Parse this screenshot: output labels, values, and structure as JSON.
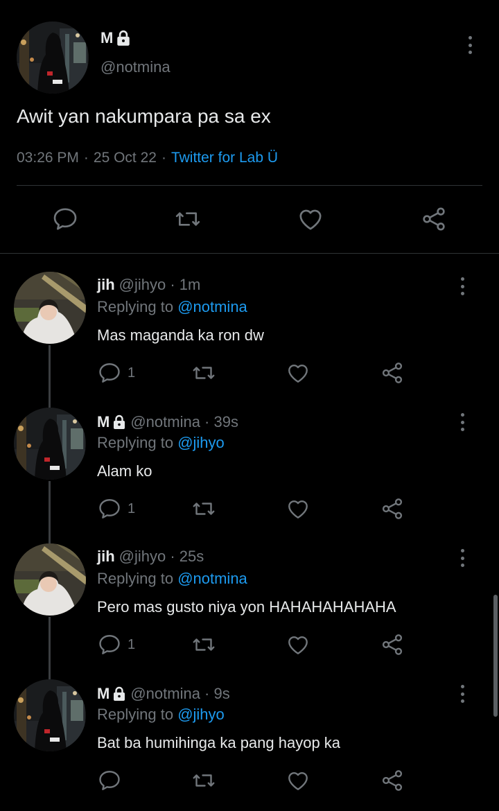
{
  "main_tweet": {
    "name": "M",
    "handle": "@notmina",
    "text": "Awit yan nakumpara pa sa ex",
    "time": "03:26 PM",
    "date": "25 Oct 22",
    "source": "Twitter for Lab Ü",
    "sep": "·"
  },
  "replies": [
    {
      "name": "jih",
      "handle": "@jihyo · 1m",
      "replying_prefix": "Replying to ",
      "replying_to": "@notmina",
      "text": "Mas maganda ka ron dw",
      "reply_count": "1"
    },
    {
      "name": "M",
      "handle": "@notmina · 39s",
      "replying_prefix": "Replying to ",
      "replying_to": "@jihyo",
      "text": "Alam ko",
      "reply_count": "1"
    },
    {
      "name": "jih",
      "handle": "@jihyo · 25s",
      "replying_prefix": "Replying to ",
      "replying_to": "@notmina",
      "text": "Pero mas gusto niya yon HAHAHAHAHAHA",
      "reply_count": "1"
    },
    {
      "name": "M",
      "handle": "@notmina · 9s",
      "replying_prefix": "Replying to ",
      "replying_to": "@jihyo",
      "text": "Bat ba humihinga ka pang hayop ka",
      "reply_count": ""
    }
  ],
  "icons": {
    "reply": "reply-icon",
    "retweet": "retweet-icon",
    "like": "heart-icon",
    "share": "share-icon",
    "more": "more-vertical-icon",
    "lock": "lock-icon"
  },
  "colors": {
    "background": "#000000",
    "text": "#e7e9ea",
    "muted": "#71767b",
    "accent": "#1d9bf0"
  }
}
